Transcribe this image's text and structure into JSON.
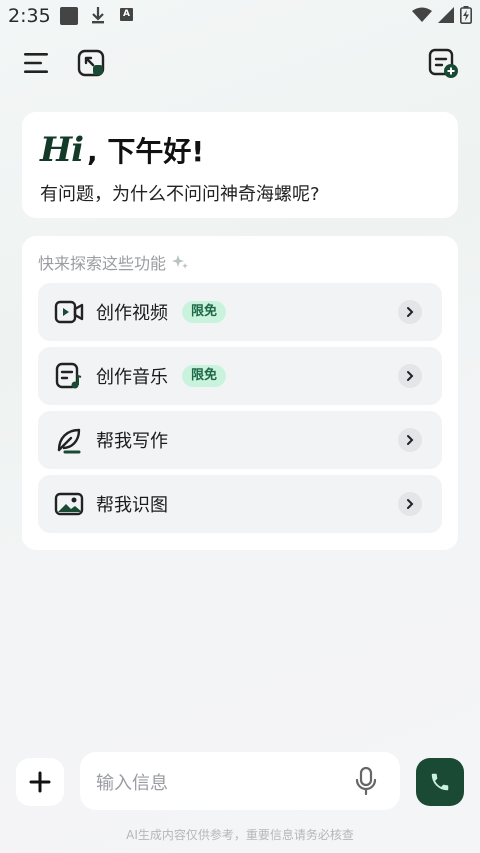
{
  "status_bar": {
    "time": "2:35",
    "notif_a": "A"
  },
  "greeting": {
    "hi": "Hi",
    "rest": ", 下午好!",
    "subtitle": "有问题，为什么不问问神奇海螺呢?"
  },
  "features": {
    "title": "快来探索这些功能",
    "items": [
      {
        "label": "创作视频",
        "badge": "限免",
        "icon": "video-icon"
      },
      {
        "label": "创作音乐",
        "badge": "限免",
        "icon": "music-note-icon"
      },
      {
        "label": "帮我写作",
        "badge": "",
        "icon": "feather-pen-icon"
      },
      {
        "label": "帮我识图",
        "badge": "",
        "icon": "image-icon"
      }
    ]
  },
  "input": {
    "placeholder": "输入信息"
  },
  "disclaimer": "AI生成内容仅供参考，重要信息请务必核查",
  "colors": {
    "accent": "#1b4a34",
    "badge_bg": "#c9f3dd",
    "badge_text": "#1f6846"
  }
}
